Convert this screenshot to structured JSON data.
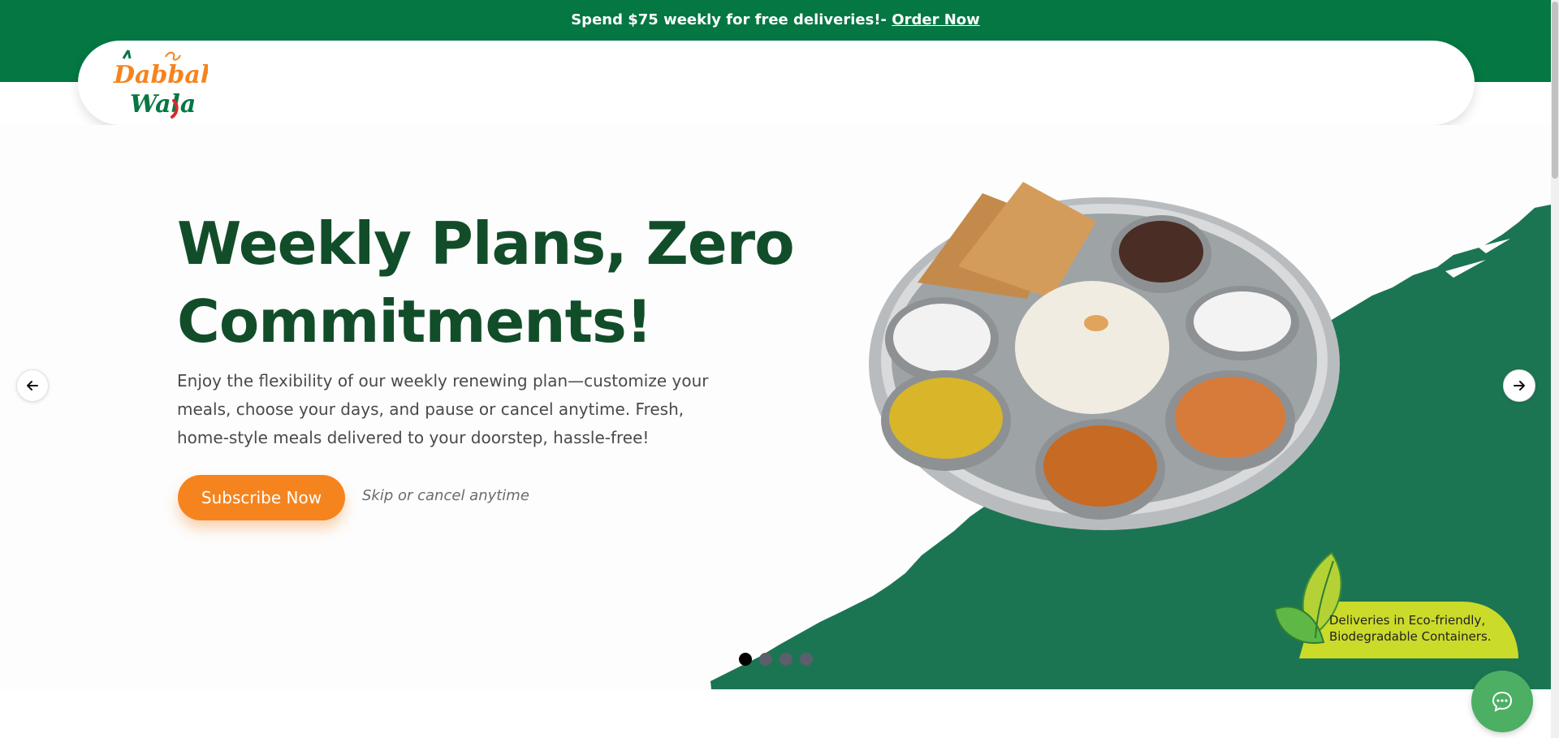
{
  "promo": {
    "text": "Spend $75 weekly for free deliveries!- ",
    "link_label": "Order Now"
  },
  "brand": {
    "logo_alt": "Dabbah Wala",
    "logo_line1": "Dabbah",
    "logo_line2": "Wala",
    "logo_colors": {
      "orange": "#f5841f",
      "green": "#047743",
      "red": "#d62b2b"
    }
  },
  "hero": {
    "title_line1": "Weekly Plans, Zero",
    "title_line2": "Commitments!",
    "description": "Enjoy the flexibility of our weekly renewing plan—customize your meals, choose your days, and pause or cancel anytime. Fresh, home-style meals delivered to your doorstep, hassle-free!",
    "cta_label": "Subscribe Now",
    "cta_note": "Skip or cancel anytime",
    "image_alt": "Indian thali platter",
    "eco_line1": "Deliveries in Eco-friendly,",
    "eco_line2": "Biodegradable Containers."
  },
  "carousel": {
    "prev_icon": "arrow-left-icon",
    "next_icon": "arrow-right-icon",
    "slide_count": 4,
    "active_index": 0
  },
  "chat": {
    "icon": "chat-bubble-icon"
  },
  "colors": {
    "primary_green": "#047743",
    "hero_green": "#1c7552",
    "title_green": "#124d2a",
    "accent_orange": "#f5841f",
    "leaf_lime": "#cbdb2a"
  }
}
